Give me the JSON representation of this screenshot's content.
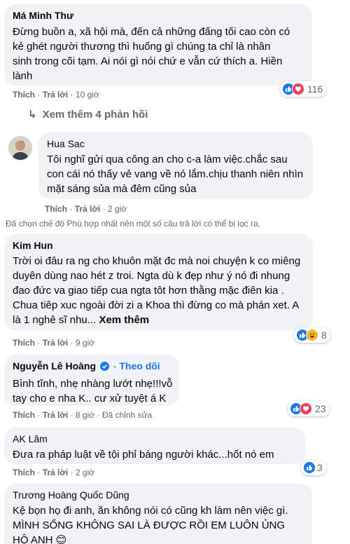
{
  "comments": [
    {
      "author": "Má Minh Thư",
      "text": "Đừng buồn a, xã hội mà, đến cả những đấng tối cao còn có kẻ ghét người thương thì huống gì chúng ta chỉ là nhân sinh trong cõi tạm. Ai nói gì nói chứ e vẫn cứ thích a. Hiền lành",
      "like": "Thích",
      "reply": "Trả lời",
      "time": "10 giờ",
      "reaction_count": "116"
    },
    {
      "author": "Hua Sac",
      "text": "Tôi nghĩ gửi qua công an cho c-a làm việc.chắc sau con cái nó thấy vẻ vang về nó lắm.chịu thanh niên nhìn mặt sáng sủa mà đêm cũng sủa",
      "like": "Thích",
      "reply": "Trả lời",
      "time": "2 giờ"
    },
    {
      "author": "Kim Hun",
      "text": "Trời oi đâu ra ng cho khuôn mặt đc mà noi chuyện k co miêng duyên dùng nao hét z troi. Ngta dù k đẹp như ý nó đi nhung đao đức va giao tiếp cua ngta tôt hơn thằng mặc điên kia . Chua tiêp xuc ngoài đời zi a Khoa thì đừng co mà phán xet. A là 1 nghê sĩ nhu...",
      "see_more": "Xem thêm",
      "like": "Thích",
      "reply": "Trả lời",
      "time": "9 giờ",
      "reaction_count": "8"
    },
    {
      "author": "Nguyễn Lê Hoàng",
      "follow": "Theo dõi",
      "text": "Bình tĩnh, nhẹ nhàng lướt nhẹ!!!vỗ tay cho e nha K.. cư xử tuyệt á K",
      "like": "Thích",
      "reply": "Trả lời",
      "time": "8 giờ",
      "edited": "Đã chỉnh sửa",
      "reaction_count": "23"
    },
    {
      "author": "AK Lâm",
      "text": "Đưa ra pháp luật về tội phỉ báng người khác...hốt nó em",
      "like": "Thích",
      "reply": "Trả lời",
      "time": "2 giờ",
      "reaction_count": "3"
    },
    {
      "author": "Trương Hoàng Quốc Dũng",
      "text": "Kệ bọn họ đi anh, ăn không nói có cũng kh làm nên việc gì. MÌNH SỐNG KHÔNG SAI LÀ ĐƯỢC RỒI EM LUÔN ỦNG HỘ ANH 😊"
    }
  ],
  "view_more_replies": "Xem thêm 4 phản hồi",
  "filter_notice": "Đã chọn chế độ Phù hợp nhất nên một số câu trả lời có thể bị lọc ra.",
  "colors": {
    "bubble": "#f0f2f5",
    "like": "#1877f2",
    "heart": "#f33e58",
    "haha": "#f7b928",
    "meta": "#65676b",
    "link": "#1877f2"
  }
}
